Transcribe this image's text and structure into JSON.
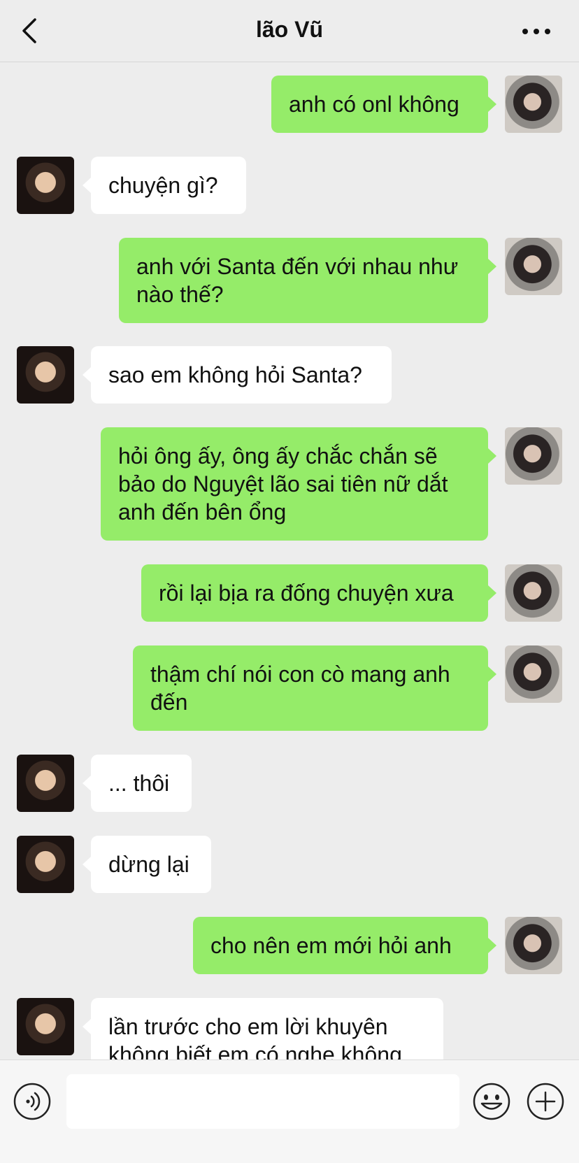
{
  "header": {
    "title": "lão Vũ",
    "back_icon": "chevron-left-icon",
    "more_icon": "more-dots-icon"
  },
  "messages": [
    {
      "side": "out",
      "text": "anh có onl không"
    },
    {
      "side": "in",
      "text": "chuyện gì?"
    },
    {
      "side": "out",
      "text": "anh với Santa đến với nhau như nào thế?"
    },
    {
      "side": "in",
      "text": "sao em không hỏi Santa?"
    },
    {
      "side": "out",
      "text": "hỏi ông ấy, ông ấy chắc chắn sẽ bảo do Nguyệt lão sai tiên nữ dắt anh đến bên ổng"
    },
    {
      "side": "out",
      "text": "rồi lại bịa ra đống chuyện xưa"
    },
    {
      "side": "out",
      "text": "thậm chí nói con cò mang anh đến"
    },
    {
      "side": "in",
      "text": "... thôi"
    },
    {
      "side": "in",
      "text": "dừng lại"
    },
    {
      "side": "out",
      "text": "cho nên em mới hỏi anh"
    },
    {
      "side": "in",
      "text": "lần trước cho em lời khuyên không biết em có nghe không"
    }
  ],
  "input_bar": {
    "voice_icon": "voice-icon",
    "input_value": "",
    "emoji_icon": "emoji-icon",
    "plus_icon": "plus-icon"
  },
  "colors": {
    "background": "#ededed",
    "bubble_out": "#95ec69",
    "bubble_in": "#ffffff"
  }
}
